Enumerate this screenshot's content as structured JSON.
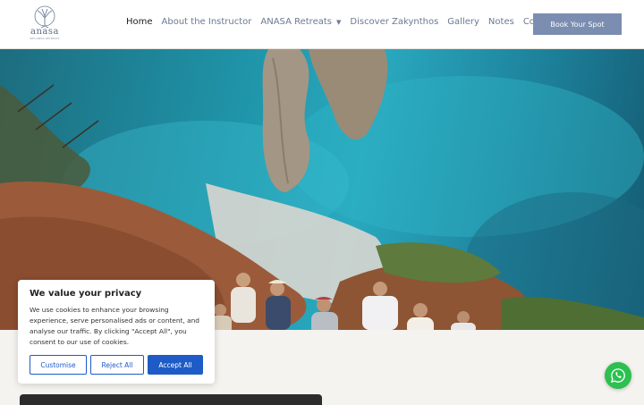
{
  "brand": {
    "logo_word": "anasa",
    "logo_sub": "WELLNESS RETREATS"
  },
  "nav": {
    "items": [
      {
        "label": "Home",
        "active": true
      },
      {
        "label": "About the Instructor"
      },
      {
        "label": "ANASA Retreats",
        "has_dropdown": true
      },
      {
        "label": "Discover Zakynthos"
      },
      {
        "label": "Gallery"
      },
      {
        "label": "Notes"
      },
      {
        "label": "Contact"
      }
    ],
    "cta_label": "Book Your Spot"
  },
  "hero": {
    "image_icon": "coastal-cliff-photo"
  },
  "cookie": {
    "title": "We value your privacy",
    "text": "We use cookies to enhance your browsing experience, serve personalised ads or content, and analyse our traffic. By clicking \"Accept All\", you consent to our use of cookies.",
    "customise_label": "Customise",
    "reject_label": "Reject All",
    "accept_label": "Accept All"
  },
  "colors": {
    "accent": "#7b8db0",
    "cookie_button": "#1e5bc6",
    "whatsapp": "#2bc04f",
    "nav_text": "#6a7a92"
  },
  "widgets": {
    "chat_icon": "whatsapp-icon"
  }
}
